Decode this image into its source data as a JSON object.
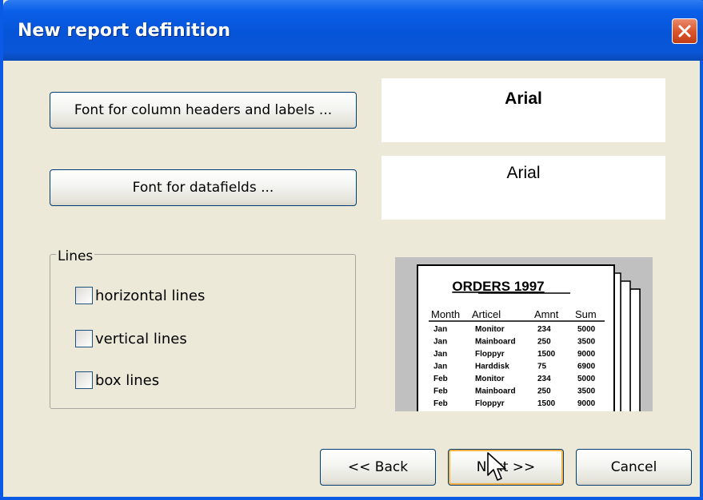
{
  "window": {
    "title": "New report definition"
  },
  "fonts": {
    "header_button_label": "Font for column headers and labels ...",
    "header_preview": "Arial",
    "data_button_label": "Font for datafields ...",
    "data_preview": "Arial"
  },
  "lines_group": {
    "label": "Lines",
    "options": [
      {
        "label": "horizontal lines",
        "checked": false
      },
      {
        "label": "vertical lines",
        "checked": false
      },
      {
        "label": "box lines",
        "checked": false
      }
    ]
  },
  "report_preview": {
    "title": "ORDERS 1997",
    "columns": [
      "Month",
      "Articel",
      "Amnt",
      "Sum"
    ],
    "rows": [
      [
        "Jan",
        "Monitor",
        "234",
        "5000"
      ],
      [
        "Jan",
        "Mainboard",
        "250",
        "3500"
      ],
      [
        "Jan",
        "Floppyr",
        "1500",
        "9000"
      ],
      [
        "Jan",
        "Harddisk",
        "75",
        "6900"
      ],
      [
        "Feb",
        "Monitor",
        "234",
        "5000"
      ],
      [
        "Feb",
        "Mainboard",
        "250",
        "3500"
      ],
      [
        "Feb",
        "Floppyr",
        "1500",
        "9000"
      ]
    ]
  },
  "footer": {
    "back_label": "<< Back",
    "next_label": "Next >>",
    "cancel_label": "Cancel"
  },
  "colors": {
    "titlebar": "#0654d8",
    "dialog_bg": "#ece9d8",
    "close_button": "#d9532b",
    "focus_ring": "#f6b244"
  },
  "icons": {
    "close": "close-icon",
    "cursor": "mouse-pointer-icon"
  }
}
